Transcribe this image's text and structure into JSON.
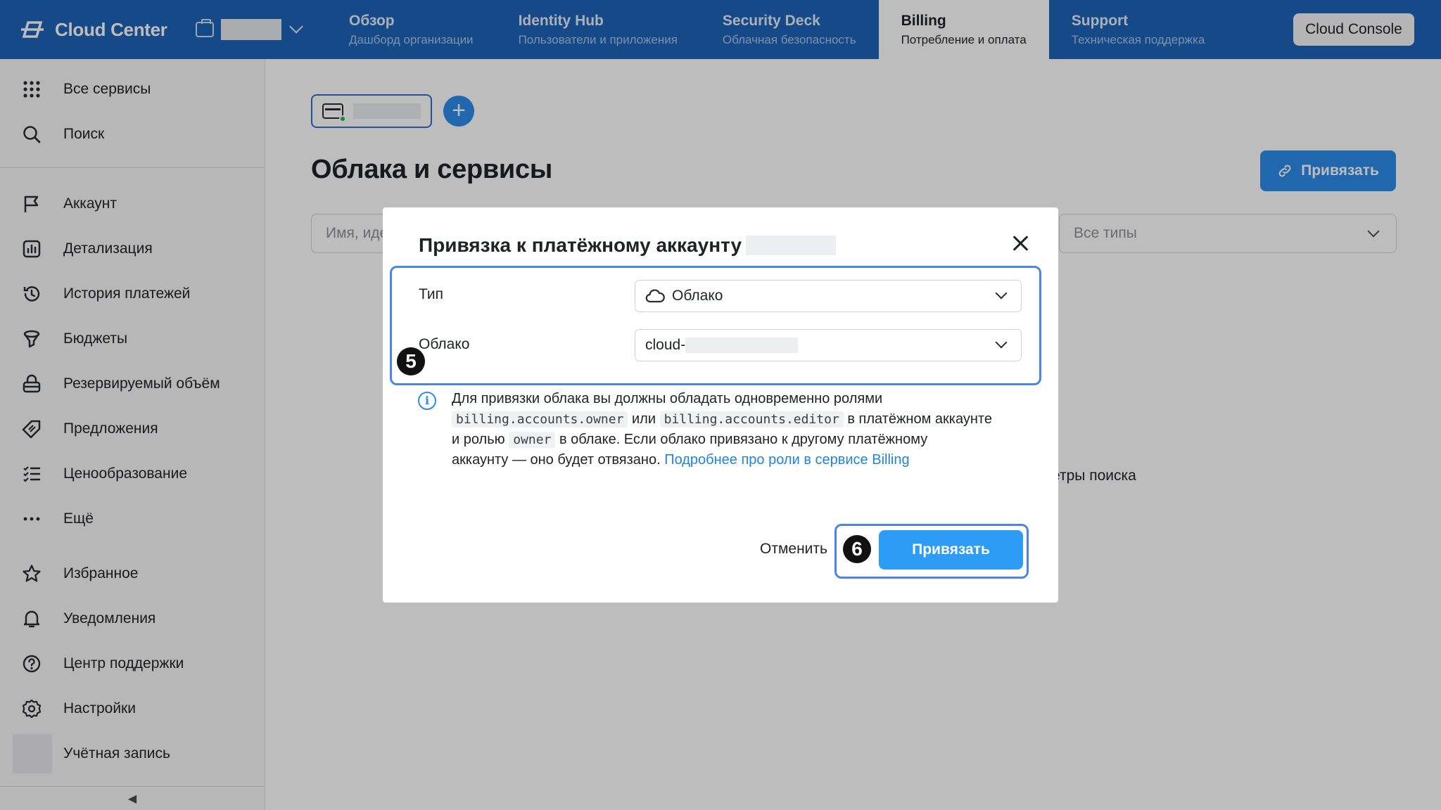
{
  "header": {
    "brand": "Cloud Center",
    "tabs": [
      {
        "title": "Обзор",
        "subtitle": "Дашборд организации"
      },
      {
        "title": "Identity Hub",
        "subtitle": "Пользователи и приложения"
      },
      {
        "title": "Security Deck",
        "subtitle": "Облачная безопасность"
      },
      {
        "title": "Billing",
        "subtitle": "Потребление и оплата"
      },
      {
        "title": "Support",
        "subtitle": "Техническая поддержка"
      }
    ],
    "console_button": "Cloud Console"
  },
  "sidebar": {
    "top": [
      {
        "label": "Все сервисы",
        "icon": "grid-icon"
      },
      {
        "label": "Поиск",
        "icon": "search-icon"
      }
    ],
    "items": [
      {
        "label": "Аккаунт",
        "icon": "flag-icon"
      },
      {
        "label": "Детализация",
        "icon": "chart-icon"
      },
      {
        "label": "История платежей",
        "icon": "history-icon"
      },
      {
        "label": "Бюджеты",
        "icon": "funnel-icon"
      },
      {
        "label": "Резервируемый объём",
        "icon": "lock-icon"
      },
      {
        "label": "Предложения",
        "icon": "tag-icon"
      },
      {
        "label": "Ценообразование",
        "icon": "list-check-icon"
      },
      {
        "label": "Ещё",
        "icon": "more-icon"
      }
    ],
    "bottom": [
      {
        "label": "Избранное",
        "icon": "star-icon"
      },
      {
        "label": "Уведомления",
        "icon": "bell-icon"
      },
      {
        "label": "Центр поддержки",
        "icon": "help-icon"
      },
      {
        "label": "Настройки",
        "icon": "gear-icon"
      },
      {
        "label": "Учётная запись",
        "icon": "avatar"
      }
    ],
    "collapse": "◀"
  },
  "main": {
    "add_button": "+",
    "title": "Облака и сервисы",
    "bind_button": "Привязать",
    "search_placeholder": "Имя, иде",
    "type_filter": "Все типы",
    "empty_hint": "етры поиска"
  },
  "modal": {
    "title": "Привязка к платёжному аккаунту",
    "fields": [
      {
        "label": "Тип",
        "value": "Облако"
      },
      {
        "label": "Облако",
        "value": "cloud-"
      }
    ],
    "info": {
      "p1": "Для привязки облака вы должны обладать одновременно ролями",
      "role_owner": "billing.accounts.owner",
      "or": "или",
      "role_editor": "billing.accounts.editor",
      "p2": "в платёжном аккаунте",
      "p3": "и ролью",
      "role_cloud": "owner",
      "p4": "в облаке. Если облако привязано к другому платёжному",
      "p5": "аккаунту — оно будет отвязано.",
      "link": "Подробнее про роли в сервисе Billing"
    },
    "cancel": "Отменить",
    "submit": "Привязать",
    "step_badges": [
      "5",
      "6"
    ]
  },
  "colors": {
    "header": "#1e63b6",
    "accent": "#2d8cea",
    "highlight": "#4c86de"
  }
}
